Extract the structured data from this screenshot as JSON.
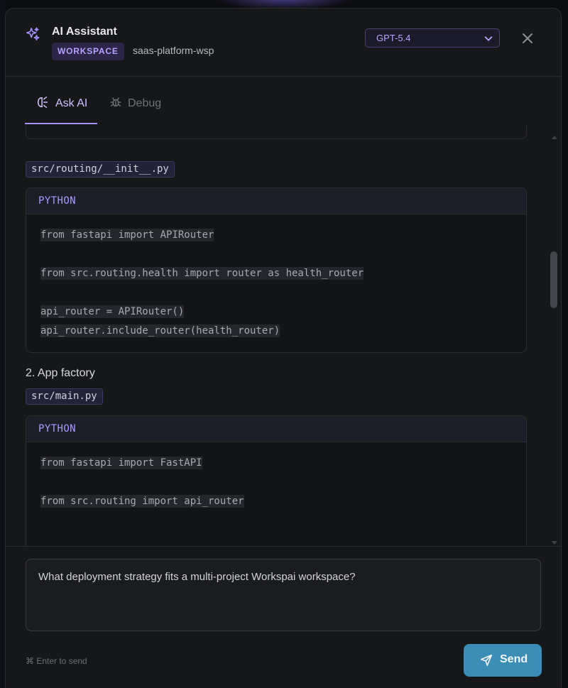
{
  "header": {
    "title": "AI Assistant",
    "workspace_badge": "WORKSPACE",
    "workspace_name": "saas-platform-wsp",
    "model_selected": "GPT-5.4"
  },
  "tabs": [
    {
      "label": "Ask AI",
      "active": true
    },
    {
      "label": "Debug",
      "active": false
    }
  ],
  "content": {
    "file1": "src/routing/__init__.py",
    "code1": {
      "language": "PYTHON",
      "lines": [
        "from fastapi import APIRouter",
        "",
        "from src.routing.health import router as health_router",
        "",
        "api_router = APIRouter()",
        "api_router.include_router(health_router)"
      ]
    },
    "section2": "2. App factory",
    "file2": "src/main.py",
    "code2": {
      "language": "PYTHON",
      "lines": [
        "from fastapi import FastAPI",
        "",
        "from src.routing import api_router"
      ]
    }
  },
  "composer": {
    "input_value": "What deployment strategy fits a multi-project Workspai workspace?",
    "hint": "⌘ Enter to send",
    "send_label": "Send"
  },
  "colors": {
    "accent": "#a592ff",
    "send_button": "#3c8db6",
    "panel_bg": "#161719"
  }
}
